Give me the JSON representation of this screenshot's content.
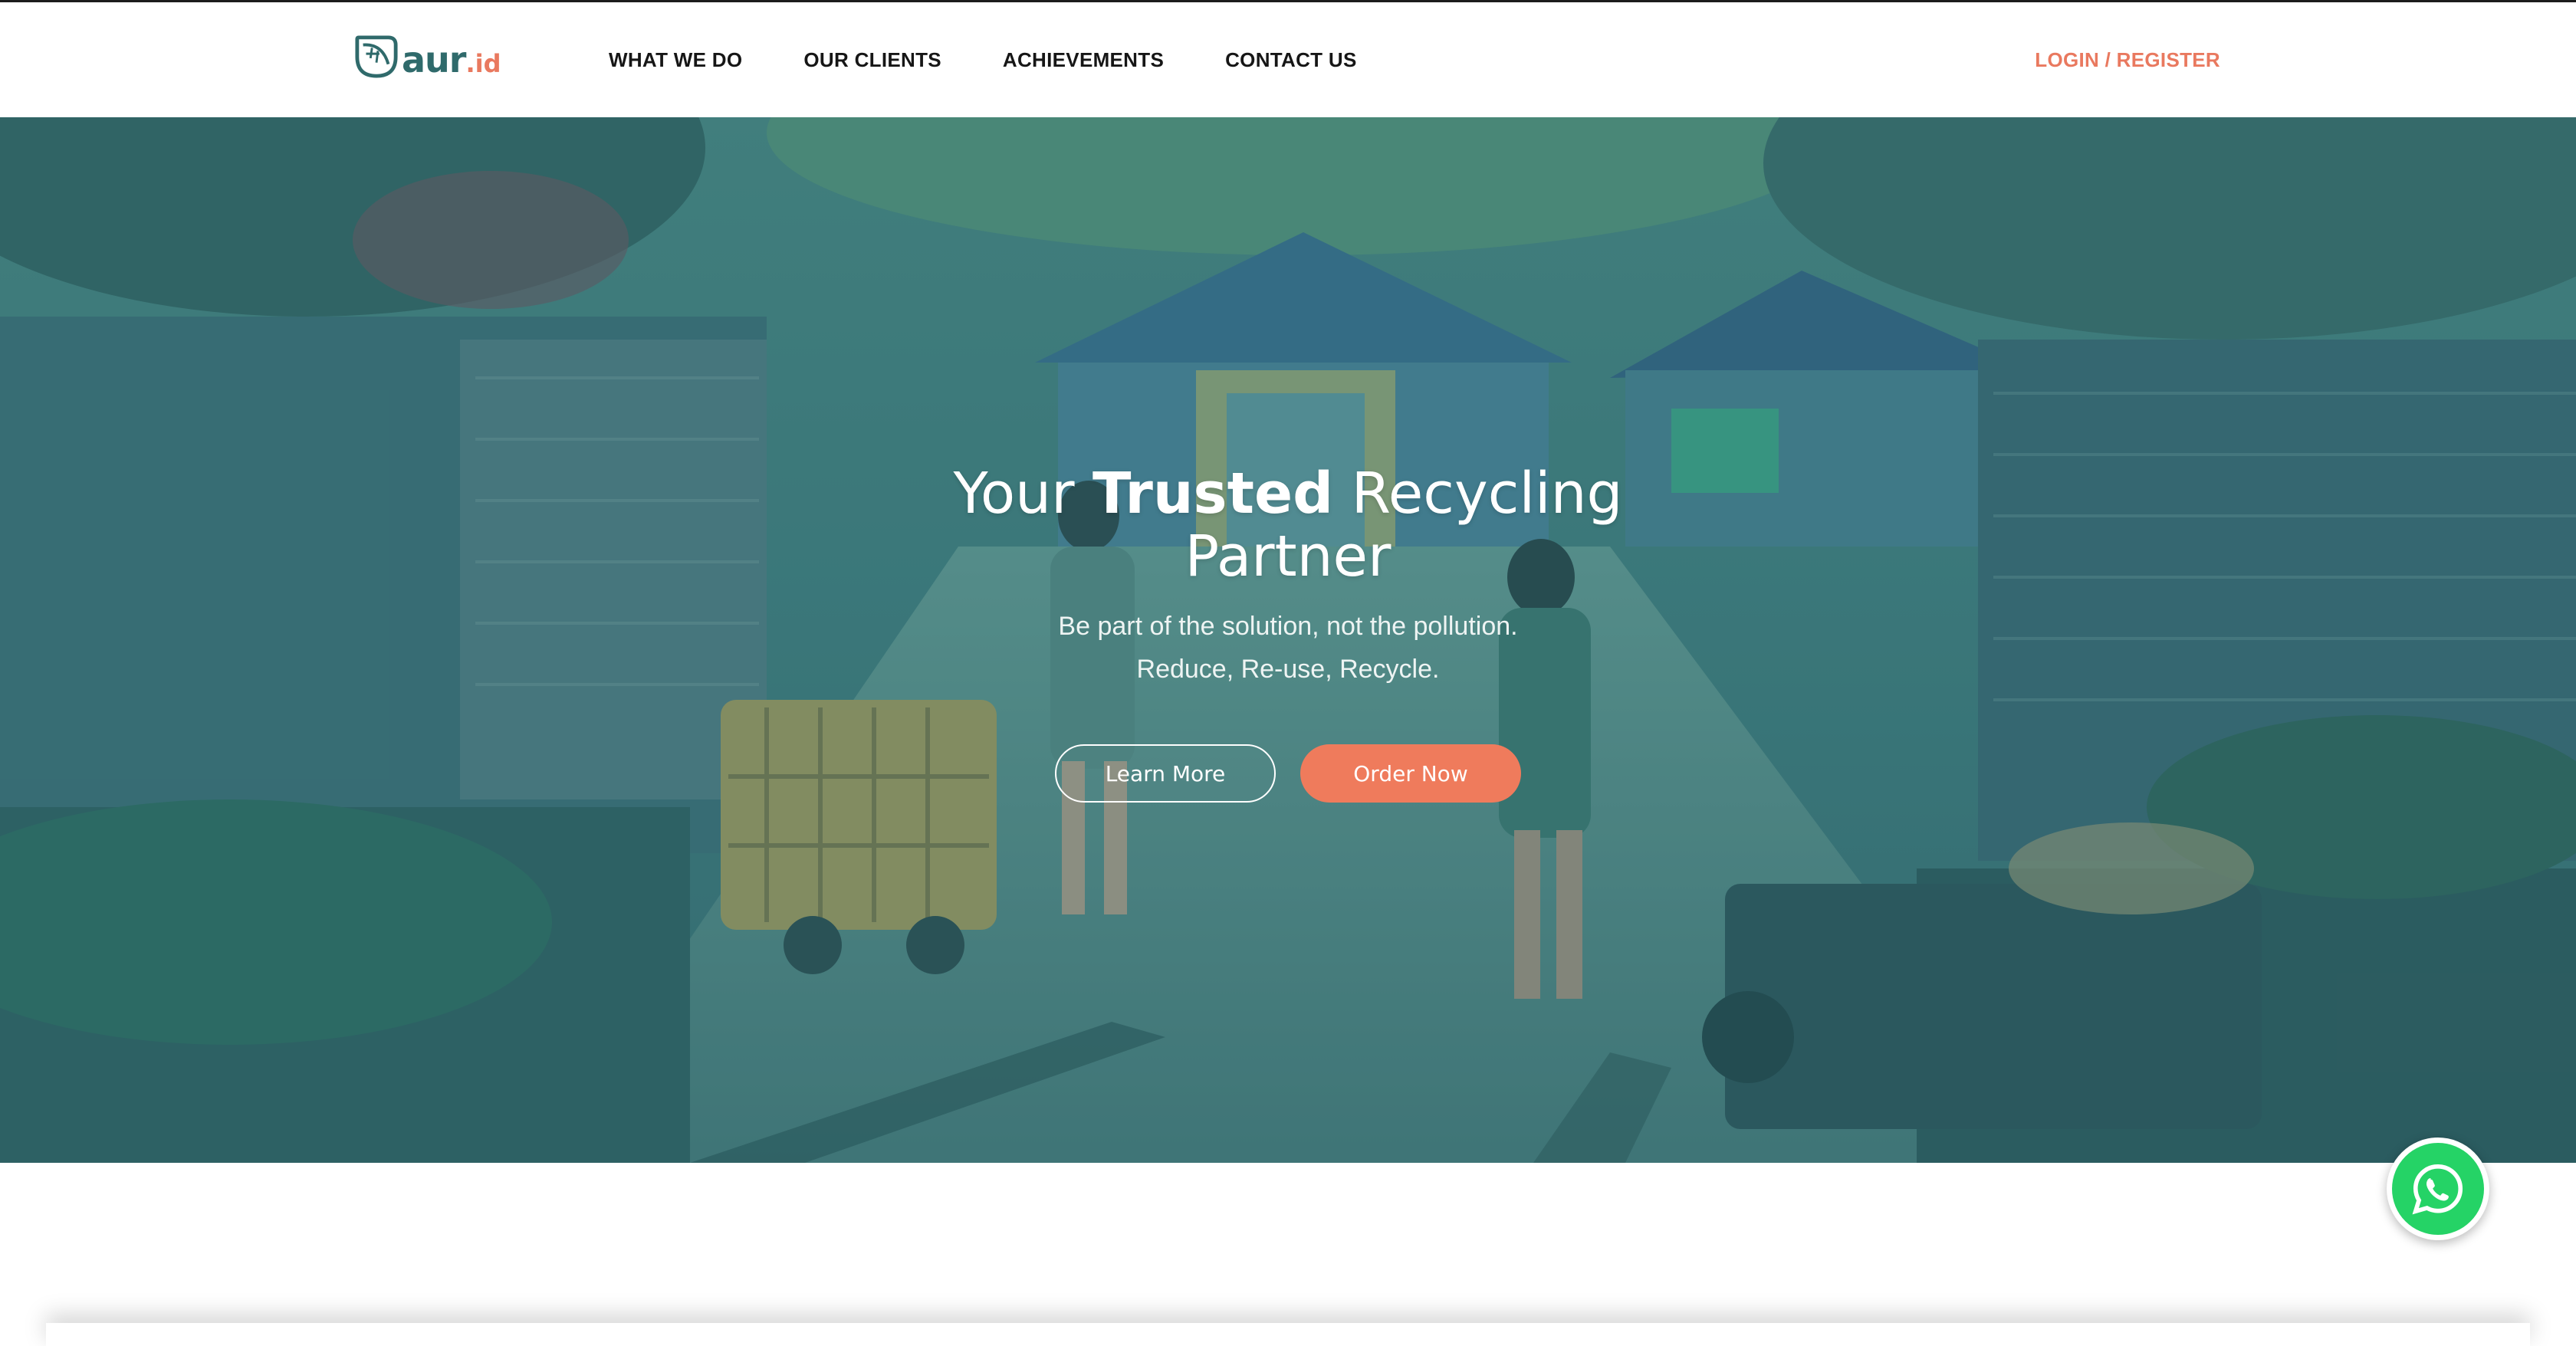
{
  "brand": {
    "name": "aur",
    "tld": ".id",
    "logo_icon": "leaf-icon",
    "colors": {
      "primary": "#2f6a6b",
      "accent": "#e9795f"
    }
  },
  "nav": {
    "items": [
      {
        "label": "WHAT WE DO"
      },
      {
        "label": "OUR CLIENTS"
      },
      {
        "label": "ACHIEVEMENTS"
      },
      {
        "label": "CONTACT US"
      }
    ],
    "login_label": "LOGIN / REGISTER"
  },
  "hero": {
    "title_pre": "Your ",
    "title_bold": "Trusted",
    "title_post": " Recycling Partner",
    "subtitle_line1": "Be part of the solution, not the pollution.",
    "subtitle_line2": "Reduce, Re-use, Recycle.",
    "btn_learn": "Learn More",
    "btn_order": "Order Now",
    "button_colors": {
      "order": "#ef7b5c"
    }
  },
  "floating": {
    "whatsapp_icon": "whatsapp-icon",
    "color": "#25d366"
  }
}
